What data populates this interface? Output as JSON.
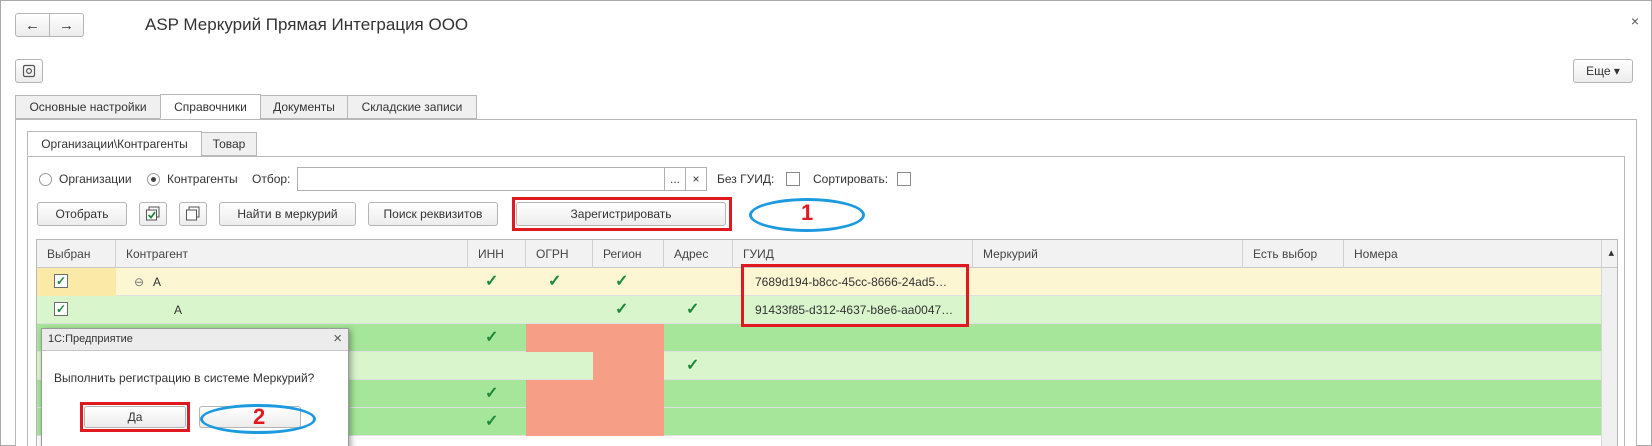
{
  "window": {
    "title": "ASP Меркурий Прямая Интеграция ООО",
    "close_glyph": "×",
    "back_glyph": "←",
    "forward_glyph": "→",
    "settings_icon": "gear-icon",
    "more_label": "Еще ▾"
  },
  "tabs": [
    "Основные настройки",
    "Справочники",
    "Документы",
    "Складские записи"
  ],
  "subtabs": [
    "Организации\\Контрагенты",
    "Товар"
  ],
  "filters": {
    "radio_org": "Организации",
    "radio_kontr": "Контрагенты",
    "filter_label": "Отбор:",
    "filter_value": "",
    "ellipsis": "...",
    "clear": "×",
    "no_guid_label": "Без ГУИД:",
    "sort_label": "Сортировать:"
  },
  "toolbar": {
    "select_label": "Отобрать",
    "find_label": "Найти в меркурий",
    "search_label": "Поиск реквизитов",
    "register_label": "Зарегистрировать"
  },
  "grid": {
    "columns": [
      "Выбран",
      "Контрагент",
      "ИНН",
      "ОГРН",
      "Регион",
      "Адрес",
      "ГУИД",
      "Меркурий",
      "Есть выбор",
      "Номера"
    ],
    "rows": [
      {
        "selected": "✓",
        "name": "A",
        "inn": "✓",
        "ogrn": "✓",
        "region": "✓",
        "addr": "",
        "guid": "7689d194-b8cc-45cc-8666-24ad5…"
      },
      {
        "selected": "✓",
        "name": "A",
        "inn": "",
        "ogrn": "",
        "region": "✓",
        "addr": "✓",
        "guid": "91433f85-d312-4637-b8e6-aa0047…"
      },
      {
        "selected": "",
        "name": "",
        "inn": "✓",
        "ogrn": "",
        "region": "",
        "addr": "",
        "guid": ""
      },
      {
        "selected": "",
        "name": "",
        "inn": "",
        "ogrn": "",
        "region": "",
        "addr": "✓",
        "guid": ""
      },
      {
        "selected": "",
        "name": "",
        "inn": "✓",
        "ogrn": "",
        "region": "",
        "addr": "",
        "guid": ""
      },
      {
        "selected": "",
        "name": "",
        "inn": "✓",
        "ogrn": "",
        "region": "",
        "addr": "",
        "guid": ""
      }
    ],
    "tree_glyph": "⊖",
    "scroll_up": "▴"
  },
  "dialog": {
    "title": "1С:Предприятие",
    "close": "×",
    "message": "Выполнить регистрацию в системе Меркурий?",
    "yes_label": "Да"
  },
  "annotations": {
    "mark1": "1",
    "mark2": "2"
  },
  "colors": {
    "highlight_red": "#e01820",
    "annotation_blue": "#1b9ae0",
    "row_yellow": "#fdf6d3",
    "row_green_light": "#d8f5cc",
    "row_green": "#a6e69a",
    "cell_salmon": "#f79e86"
  }
}
